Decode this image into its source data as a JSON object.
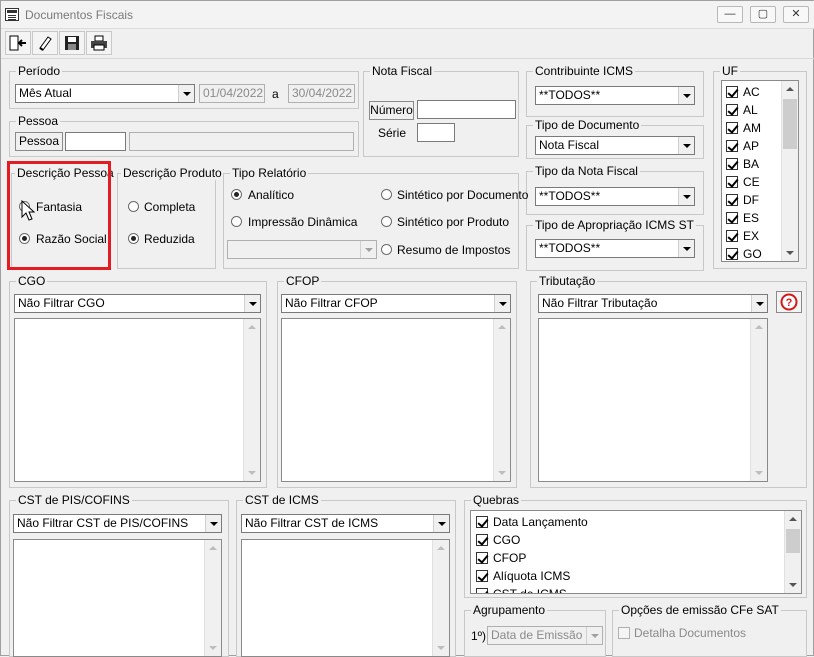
{
  "window": {
    "title": "Documentos Fiscais",
    "buttons": {
      "minimize": "—",
      "maximize": "▢",
      "close": "✕"
    }
  },
  "toolbar": {
    "icons": [
      "exit-icon",
      "eraser-icon",
      "save-icon",
      "print-icon"
    ]
  },
  "periodo": {
    "label": "Período",
    "selected": "Mês Atual",
    "date_from": "01/04/2022",
    "separator": "a",
    "date_to": "30/04/2022"
  },
  "nota_fiscal": {
    "label": "Nota Fiscal",
    "numero_button": "Número",
    "numero_value": "",
    "serie_label": "Série",
    "serie_value": ""
  },
  "pessoa": {
    "label": "Pessoa",
    "button": "Pessoa",
    "code_value": "",
    "name_value": ""
  },
  "contribuinte_icms": {
    "label": "Contribuinte ICMS",
    "selected": "**TODOS**"
  },
  "tipo_documento": {
    "label": "Tipo de Documento",
    "selected": "Nota Fiscal"
  },
  "tipo_nota_fiscal": {
    "label": "Tipo da Nota Fiscal",
    "selected": "**TODOS**"
  },
  "tipo_apropriacao": {
    "label": "Tipo de Apropriação ICMS ST",
    "selected": "**TODOS**"
  },
  "uf": {
    "label": "UF",
    "items": [
      {
        "label": "AC",
        "checked": true
      },
      {
        "label": "AL",
        "checked": true
      },
      {
        "label": "AM",
        "checked": true
      },
      {
        "label": "AP",
        "checked": true
      },
      {
        "label": "BA",
        "checked": true
      },
      {
        "label": "CE",
        "checked": true
      },
      {
        "label": "DF",
        "checked": true
      },
      {
        "label": "ES",
        "checked": true
      },
      {
        "label": "EX",
        "checked": true
      },
      {
        "label": "GO",
        "checked": true
      }
    ]
  },
  "descricao_pessoa": {
    "label": "Descrição Pessoa",
    "options": [
      {
        "label": "Fantasia",
        "selected": false
      },
      {
        "label": "Razão Social",
        "selected": true
      }
    ]
  },
  "descricao_produto": {
    "label": "Descrição Produto",
    "options": [
      {
        "label": "Completa",
        "selected": false
      },
      {
        "label": "Reduzida",
        "selected": true
      }
    ]
  },
  "tipo_relatorio": {
    "label": "Tipo Relatório",
    "options": [
      {
        "label": "Analítico",
        "selected": true
      },
      {
        "label": "Impressão Dinâmica",
        "selected": false
      },
      {
        "label": "Sintético por Documento",
        "selected": false
      },
      {
        "label": "Sintético por Produto",
        "selected": false
      },
      {
        "label": "Resumo de Impostos",
        "selected": false
      }
    ],
    "dynamic_combo": ""
  },
  "cgo": {
    "label": "CGO",
    "selected": "Não Filtrar CGO"
  },
  "cfop": {
    "label": "CFOP",
    "selected": "Não Filtrar CFOP"
  },
  "tributacao": {
    "label": "Tributação",
    "selected": "Não Filtrar Tributação",
    "help": "?"
  },
  "cst_pis": {
    "label": "CST de PIS/COFINS",
    "selected": "Não Filtrar CST de PIS/COFINS"
  },
  "cst_icms": {
    "label": "CST de ICMS",
    "selected": "Não Filtrar CST de ICMS"
  },
  "quebras": {
    "label": "Quebras",
    "items": [
      {
        "label": "Data Lançamento",
        "checked": true
      },
      {
        "label": "CGO",
        "checked": true
      },
      {
        "label": "CFOP",
        "checked": true
      },
      {
        "label": "Alíquota ICMS",
        "checked": true
      },
      {
        "label": "CST de ICMS",
        "checked": true
      }
    ]
  },
  "agrupamento": {
    "label": "Agrupamento",
    "prefix": "1º)",
    "selected": "Data de Emissão"
  },
  "opcoes_cfe": {
    "label": "Opções de emissão CFe SAT",
    "detalha_label": "Detalha Documentos",
    "detalha_checked": false
  },
  "colors": {
    "highlight": "#e31b23",
    "help": "#d11a1a"
  }
}
